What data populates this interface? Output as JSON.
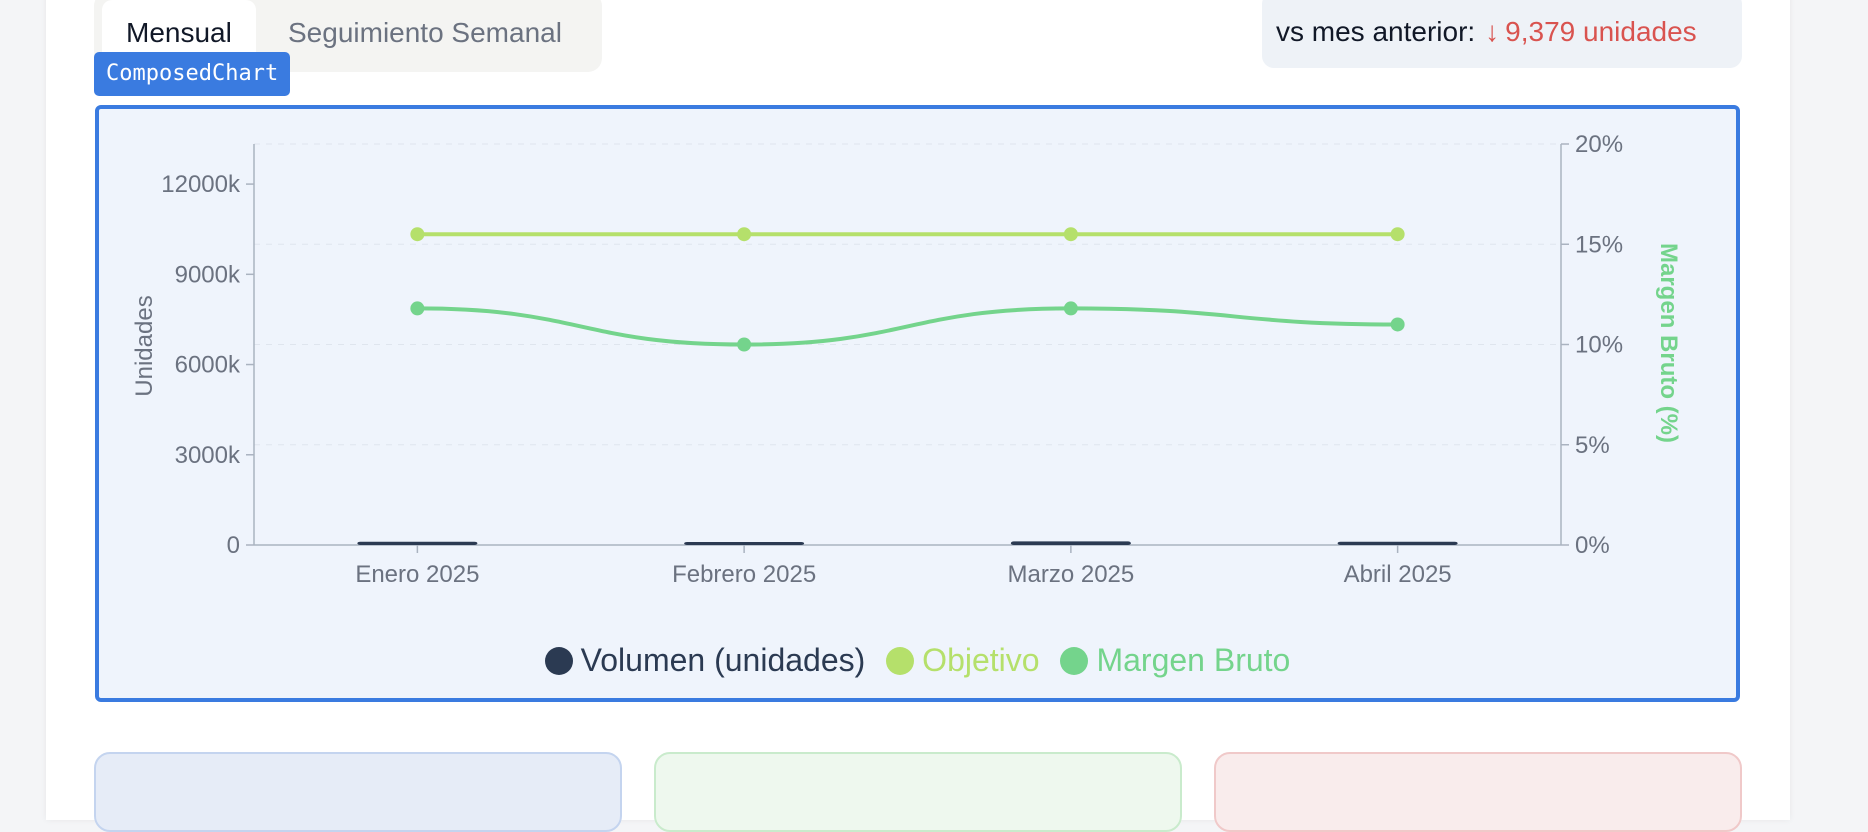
{
  "tabs": [
    {
      "label": "Mensual",
      "active": true
    },
    {
      "label": "Seguimiento Semanal",
      "active": false
    }
  ],
  "comparison": {
    "label": "vs mes anterior:",
    "arrow": "↓",
    "value": "9,379 unidades",
    "color": "#d9534f"
  },
  "component_tag": "ComposedChart",
  "colors": {
    "accent": "#3a7be0",
    "volumen": "#2b3a52",
    "objetivo": "#b5e06b",
    "margen": "#74d48c",
    "chart_bg": "#eff4fc"
  },
  "chart_data": {
    "type": "bar",
    "categories": [
      "Enero 2025",
      "Febrero 2025",
      "Marzo 2025",
      "Abril 2025"
    ],
    "series": [
      {
        "name": "Volumen (unidades)",
        "type": "bar",
        "axis": "left",
        "values": [
          110,
          101,
          120,
          110
        ],
        "color": "#2b3a52"
      },
      {
        "name": "Objetivo",
        "type": "line",
        "axis": "right",
        "values": [
          15.5,
          15.5,
          15.5,
          15.5
        ],
        "color": "#b5e06b"
      },
      {
        "name": "Margen Bruto",
        "type": "line",
        "axis": "right",
        "values": [
          11.8,
          10.0,
          11.8,
          11.0
        ],
        "color": "#74d48c"
      }
    ],
    "y_left": {
      "label": "Unidades",
      "ticks": [
        0,
        3000,
        6000,
        9000,
        12000
      ],
      "tick_labels": [
        "0",
        "3000k",
        "6000k",
        "9000k",
        "12000k"
      ],
      "range": [
        0,
        13333
      ]
    },
    "y_right": {
      "label": "Margen Bruto (%)",
      "ticks": [
        0,
        5,
        10,
        15,
        20
      ],
      "tick_labels": [
        "0%",
        "5%",
        "10%",
        "15%",
        "20%"
      ],
      "range": [
        0,
        20
      ]
    },
    "grid": true,
    "legend": "bottom"
  }
}
